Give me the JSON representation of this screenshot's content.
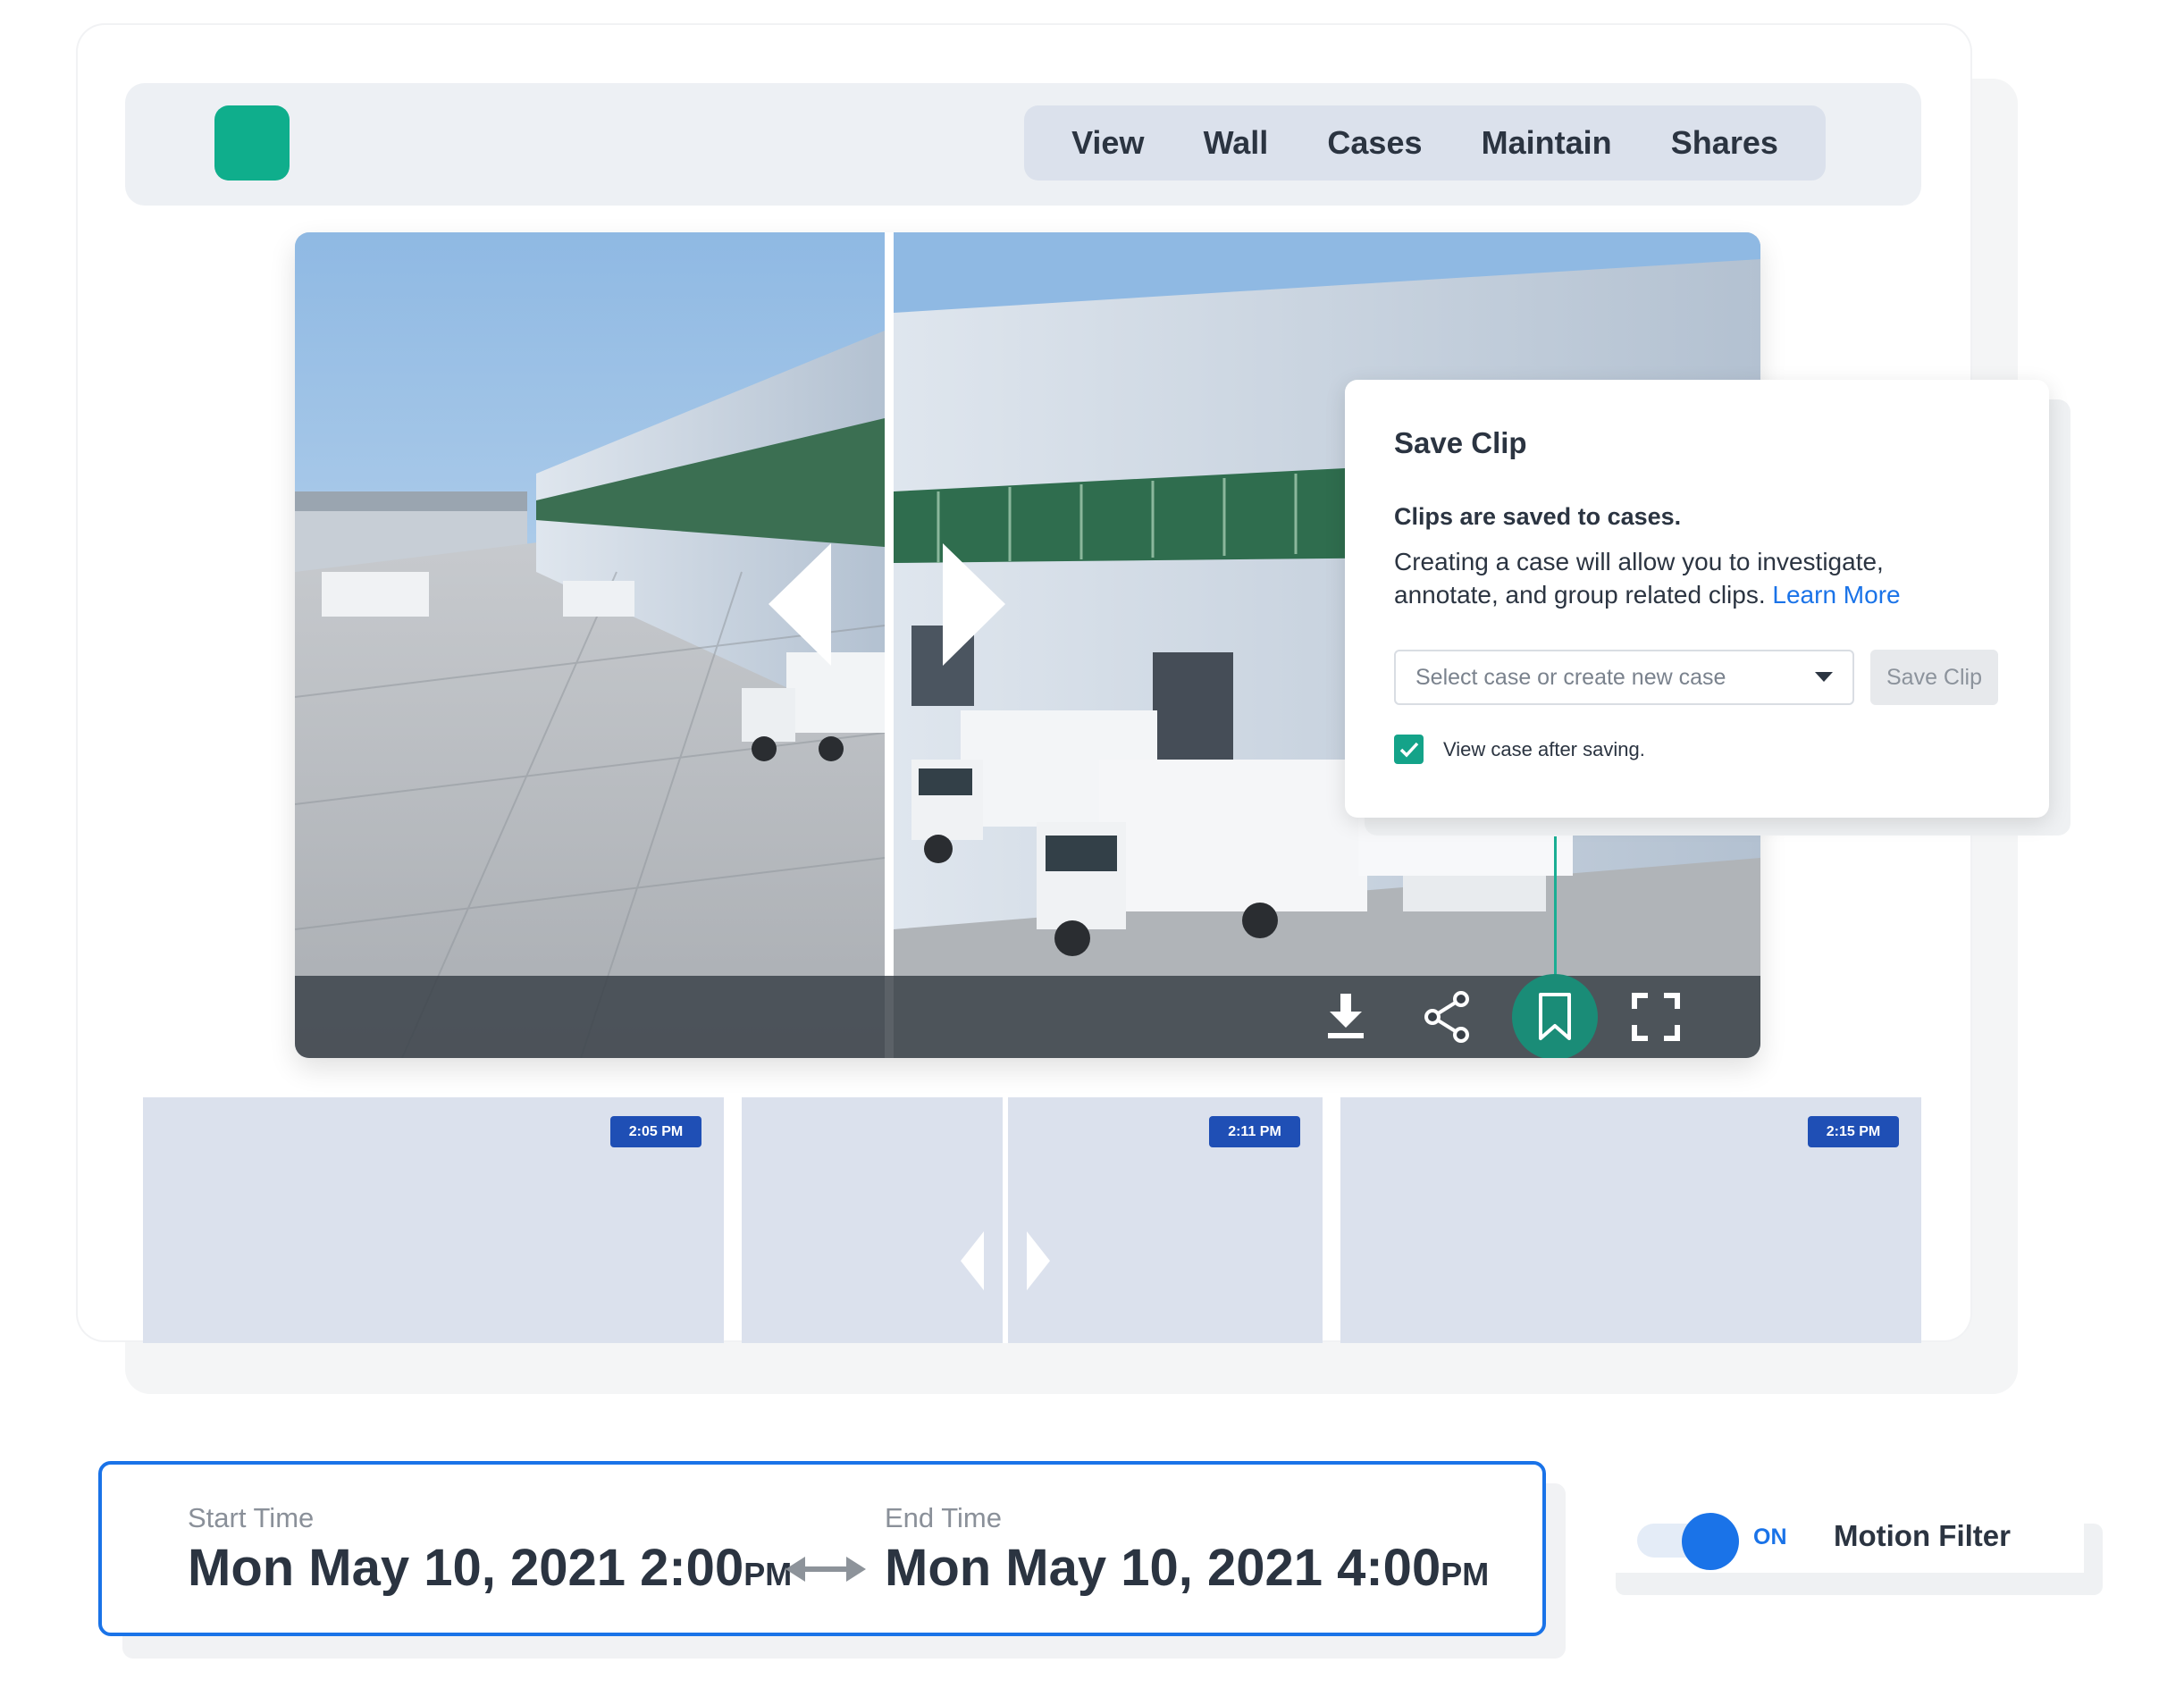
{
  "nav": {
    "tabs": [
      "View",
      "Wall",
      "Cases",
      "Maintain",
      "Shares"
    ]
  },
  "video": {
    "toolbar_icons": [
      "download-icon",
      "share-icon",
      "bookmark-icon",
      "fullscreen-icon"
    ]
  },
  "save_clip": {
    "title": "Save Clip",
    "subtitle": "Clips are saved to cases.",
    "body": "Creating a case will allow you to investigate, annotate, and group related clips.",
    "link": "Learn More",
    "select_placeholder": "Select case or create new case",
    "save_button": "Save Clip",
    "checkbox_label": "View case after saving.",
    "checkbox_checked": true
  },
  "thumbnails": [
    {
      "time": "2:05 PM"
    },
    {
      "time": "2:11 PM"
    },
    {
      "time": "2:15 PM"
    }
  ],
  "time_range": {
    "start_label": "Start Time",
    "start_value": "Mon May 10, 2021 2:00",
    "start_ampm": "PM",
    "end_label": "End Time",
    "end_value": "Mon May 10, 2021 4:00",
    "end_ampm": "PM"
  },
  "motion_filter": {
    "state": "ON",
    "label": "Motion Filter"
  },
  "colors": {
    "accent_green": "#0fae8c",
    "accent_blue": "#1a73e8",
    "badge_blue": "#1f4fb5"
  }
}
